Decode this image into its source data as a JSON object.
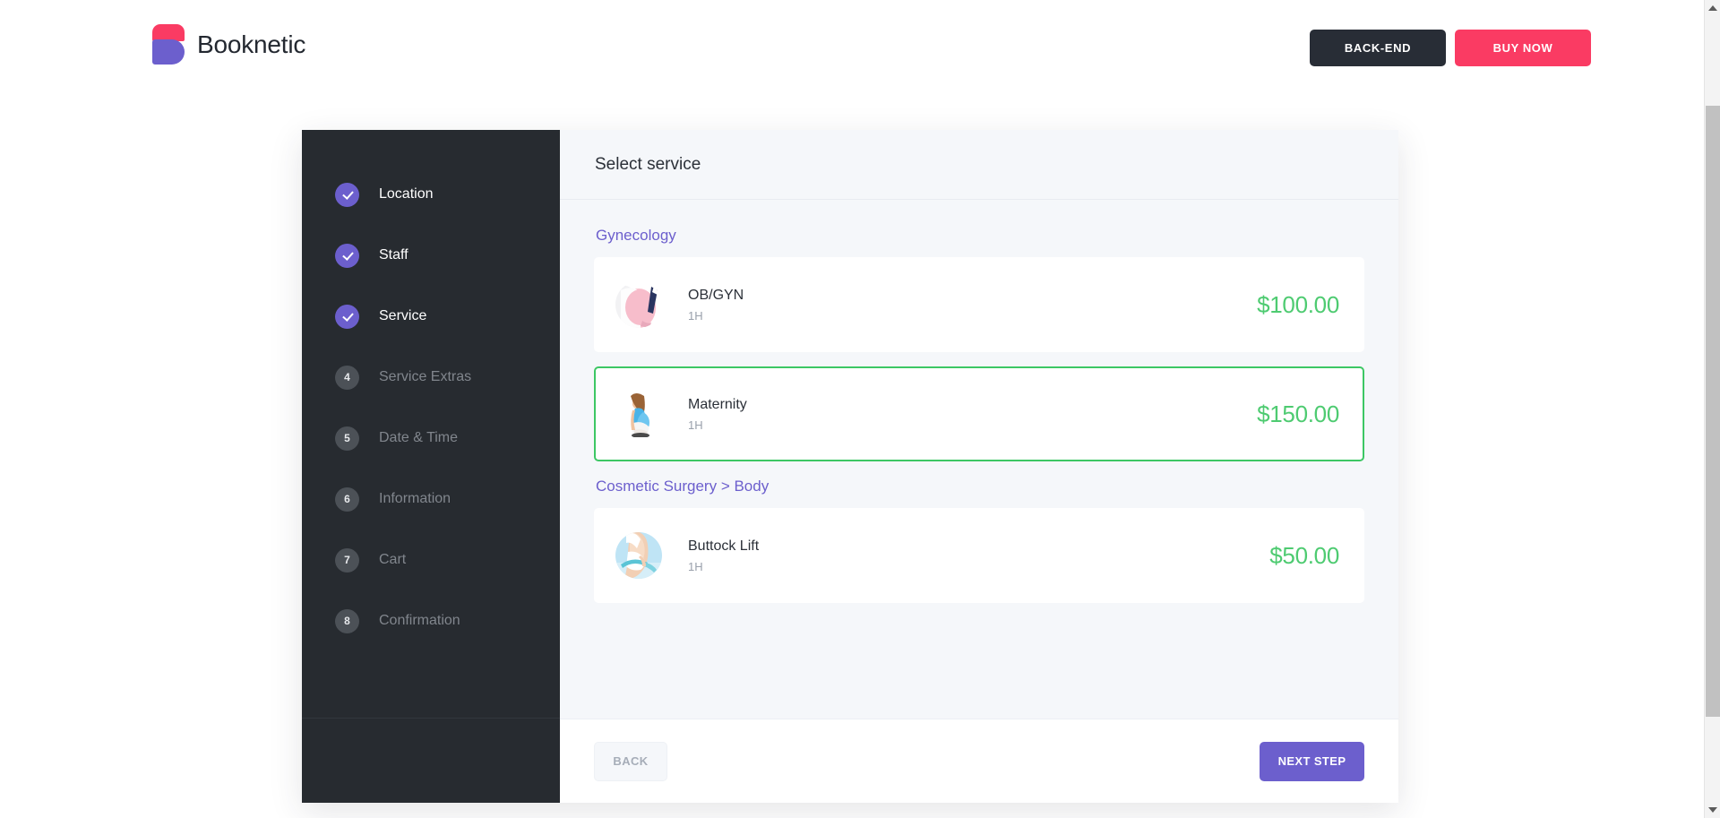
{
  "header": {
    "brand_name": "Booknetic",
    "logo_colors": {
      "top": "#fa3b63",
      "bottom": "#6c5fcd"
    },
    "buttons": {
      "backend": "BACK-END",
      "buy_now": "BUY NOW"
    }
  },
  "sidebar": {
    "steps": [
      {
        "number": "1",
        "label": "Location",
        "state": "done"
      },
      {
        "number": "2",
        "label": "Staff",
        "state": "done"
      },
      {
        "number": "3",
        "label": "Service",
        "state": "done"
      },
      {
        "number": "4",
        "label": "Service Extras",
        "state": "todo"
      },
      {
        "number": "5",
        "label": "Date & Time",
        "state": "todo"
      },
      {
        "number": "6",
        "label": "Information",
        "state": "todo"
      },
      {
        "number": "7",
        "label": "Cart",
        "state": "todo"
      },
      {
        "number": "8",
        "label": "Confirmation",
        "state": "todo"
      }
    ]
  },
  "content": {
    "title": "Select service",
    "categories": [
      {
        "name": "Gynecology",
        "services": [
          {
            "name": "OB/GYN",
            "duration": "1H",
            "price": "$100.00",
            "selected": false,
            "avatar": "pregnant-belly-pink-photo"
          },
          {
            "name": "Maternity",
            "duration": "1H",
            "price": "$150.00",
            "selected": true,
            "avatar": "pregnant-woman-blue-top-photo"
          }
        ]
      },
      {
        "name": "Cosmetic Surgery > Body",
        "services": [
          {
            "name": "Buttock Lift",
            "duration": "1H",
            "price": "$50.00",
            "selected": false,
            "avatar": "body-measuring-tape-photo"
          }
        ]
      }
    ]
  },
  "footer": {
    "back_label": "BACK",
    "next_label": "NEXT STEP"
  },
  "colors": {
    "accent_purple": "#6c5fcd",
    "accent_pink": "#fa3b63",
    "price_green": "#4ecb71",
    "selected_border_green": "#3dc764",
    "sidebar_dark": "#272b30"
  }
}
